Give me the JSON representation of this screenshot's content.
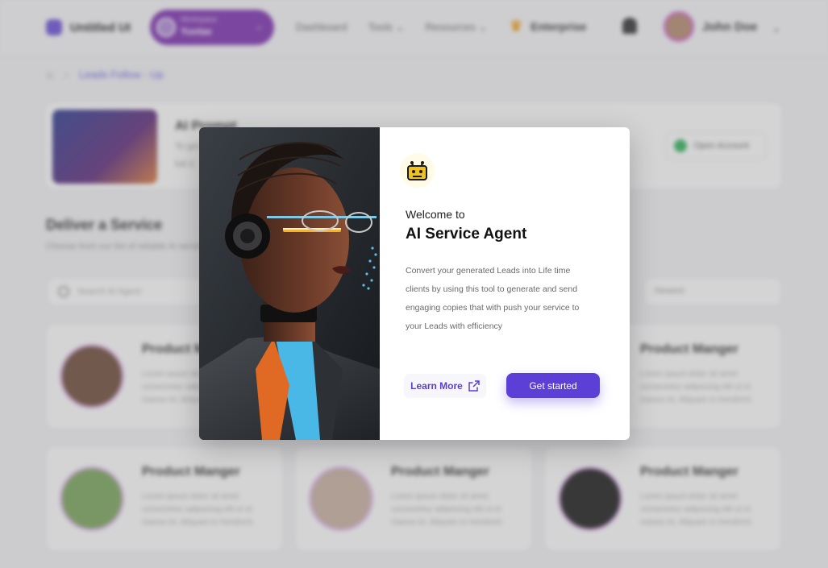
{
  "app": {
    "brand": "Untitled UI"
  },
  "workspace": {
    "label": "Workspace",
    "name": "Yuvtax"
  },
  "nav": {
    "dashboard": "Dashboard",
    "tools": "Tools",
    "resources": "Resources",
    "enterprise": "Enterprise"
  },
  "user": {
    "name": "John Doe"
  },
  "breadcrumb": {
    "current": "Leads Follow - Up"
  },
  "hero": {
    "title": "AI Prompt",
    "text_line1": "To get",
    "text_line2": "full d",
    "button": "Open Account"
  },
  "section": {
    "title": "Deliver a Service",
    "subtitle": "Choose from our list of reliable AI services"
  },
  "search": {
    "placeholder": "Search AI Agent"
  },
  "filter": {
    "label": "Newest"
  },
  "cards": [
    {
      "title": "Product Manger",
      "text1": "Lorem ipsum dolor sit amet",
      "text2": "consectetur adipiscing elit ut et",
      "text3": "massa mi. Aliquam in hendrerit."
    },
    {
      "title": "Product Manger",
      "text1": "Lorem ipsum dolor sit amet",
      "text2": "consectetur adipiscing elit ut et",
      "text3": "massa mi. Aliquam in hendrerit."
    },
    {
      "title": "Product Manger",
      "text1": "Lorem ipsum dolor sit amet",
      "text2": "consectetur adipiscing elit ut et",
      "text3": "massa mi. Aliquam in hendrerit."
    },
    {
      "title": "Product Manger",
      "text1": "Lorem ipsum dolor sit amet",
      "text2": "consectetur adipiscing elit ut et",
      "text3": "massa mi. Aliquam in hendrerit."
    },
    {
      "title": "Product Manger",
      "text1": "Lorem ipsum dolor sit amet",
      "text2": "consectetur adipiscing elit ut et",
      "text3": "massa mi. Aliquam in hendrerit."
    }
  ],
  "modal": {
    "welcome": "Welcome to",
    "title": "AI Service Agent",
    "desc_line1": "Convert your generated Leads into Life time",
    "desc_line2": "clients by  using this tool to generate and send",
    "desc_line3": "engaging copies that with push your service to",
    "desc_line4": "your Leads with efficiency",
    "learn_more": "Learn More",
    "get_started": "Get started"
  },
  "colors": {
    "accent": "#5c3fd6",
    "workspace": "#7d2fb0",
    "bot_icon": "#f2c21a"
  },
  "icons": [
    "home-icon",
    "chevron-right-icon",
    "crown-icon",
    "bell-icon",
    "robot-icon",
    "external-link-icon",
    "search-icon"
  ]
}
